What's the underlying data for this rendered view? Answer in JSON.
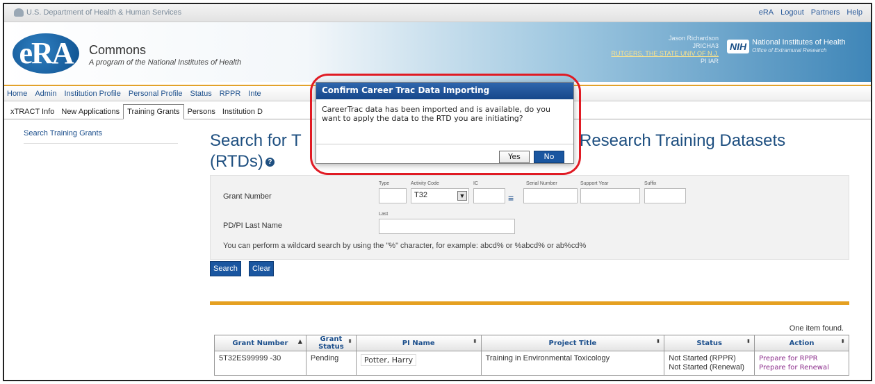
{
  "topbar": {
    "agency": "U.S. Department of Health & Human Services",
    "links": [
      "eRA",
      "Logout",
      "Partners",
      "Help"
    ]
  },
  "header": {
    "logo_text": "eRA",
    "app_name": "Commons",
    "tagline": "A program of the National Institutes of Health",
    "user_name": "Jason Richardson",
    "user_id": "JRICHA3",
    "organization": "RUTGERS, THE STATE UNIV OF N.J.",
    "roles": "PI  IAR",
    "nih_abbr": "NIH",
    "nih_name": "National Institutes of Health",
    "nih_office": "Office of Extramural Research"
  },
  "mainnav": [
    "Home",
    "Admin",
    "Institution Profile",
    "Personal Profile",
    "Status",
    "RPPR",
    "Inte"
  ],
  "subtabs": [
    "xTRACT Info",
    "New Applications",
    "Training Grants",
    "Persons",
    "Institution D"
  ],
  "leftnav": {
    "item": "Search Training Grants"
  },
  "page": {
    "title_left": "Search for T",
    "title_right": "Research Training Datasets",
    "title_line2": "(RTDs)",
    "help_glyph": "?"
  },
  "form": {
    "grant_number_label": "Grant Number",
    "type_label": "Type",
    "activity_code_label": "Activity Code",
    "ic_label": "IC",
    "serial_label": "Serial Number",
    "support_year_label": "Support Year",
    "suffix_label": "Suffix",
    "activity_code_value": "T32",
    "pdpi_label": "PD/PI Last Name",
    "last_label": "Last",
    "wildcard_hint": "You can perform a wildcard search by using the \"%\" character, for example: abcd% or %abcd% or ab%cd%",
    "search_button": "Search",
    "clear_button": "Clear"
  },
  "results": {
    "count_text": "One item found.",
    "columns": [
      "Grant Number",
      "Grant Status",
      "PI Name",
      "Project Title",
      "Status",
      "Action"
    ],
    "rows": [
      {
        "grant_number": "5T32ES99999 -30",
        "grant_status": "Pending",
        "pi_name": "Potter, Harry",
        "project_title": "Training in Environmental Toxicology",
        "status_1": "Not Started (RPPR)",
        "status_2": "Not Started (Renewal)",
        "action_1": "Prepare for RPPR",
        "action_2": "Prepare for Renewal"
      }
    ]
  },
  "modal": {
    "title": "Confirm Career Trac Data Importing",
    "message": "CareerTrac data has been imported and is available, do you want to apply the data to the RTD you are initiating?",
    "yes": "Yes",
    "no": "No"
  },
  "colors": {
    "accent_orange": "#e5a020",
    "nav_blue": "#1c4f8c",
    "button_blue": "#1a56a0",
    "highlight_red": "#e01b24"
  }
}
